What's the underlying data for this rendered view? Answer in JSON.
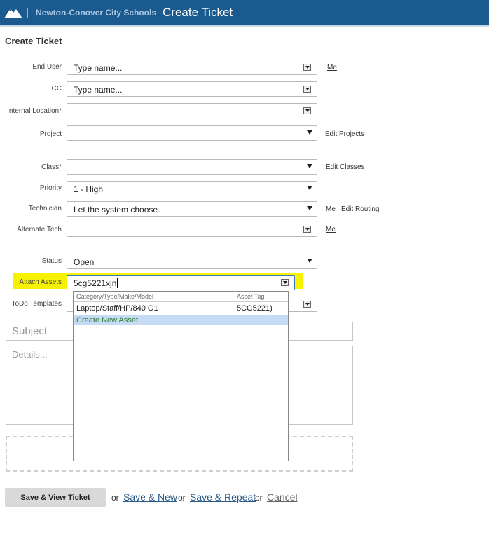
{
  "header": {
    "org_name": "Newton-Conover City Schools",
    "app_title": "Create Ticket",
    "logo_icon": "mountain-logo-icon"
  },
  "page_title": "Create Ticket",
  "form": {
    "end_user": {
      "label": "End User",
      "placeholder": "Type name...",
      "me_link": "Me"
    },
    "cc": {
      "label": "CC",
      "placeholder": "Type name..."
    },
    "internal_location": {
      "label": "Internal Location*",
      "value": ""
    },
    "project": {
      "label": "Project",
      "value": "",
      "edit_link": "Edit Projects"
    },
    "class": {
      "label": "Class*",
      "value": "",
      "edit_link": "Edit Classes"
    },
    "priority": {
      "label": "Priority",
      "value": "1 - High"
    },
    "technician": {
      "label": "Technician",
      "value": "Let the system choose.",
      "me_link": "Me",
      "edit_routing_link": "Edit Routing"
    },
    "alternate_tech": {
      "label": "Alternate Tech",
      "value": "",
      "me_link": "Me"
    },
    "status": {
      "label": "Status",
      "value": "Open"
    },
    "attach_assets": {
      "label": "Attach Assets",
      "value": "5cg5221xjn"
    },
    "todo_templates": {
      "label": "ToDo Templates",
      "value": ""
    }
  },
  "asset_dropdown": {
    "col_category": "Category/Type/Make/Model",
    "col_tag": "Asset Tag",
    "results": [
      {
        "category": "Laptop/Staff/HP/840 G1",
        "tag": "5CG5221)"
      }
    ],
    "create_new": "Create New Asset"
  },
  "subject_placeholder": "Subject",
  "details_placeholder": "Details...",
  "actions": {
    "save_view": "Save & View Ticket",
    "or": "or",
    "save_new": "Save & New",
    "save_repeat": "Save & Repeat",
    "cancel": "Cancel"
  },
  "colors": {
    "header_bg": "#1a5a8e",
    "highlight": "#f7f200",
    "selected_row": "#c6dcf5",
    "create_new_text": "#2c7a2c"
  }
}
